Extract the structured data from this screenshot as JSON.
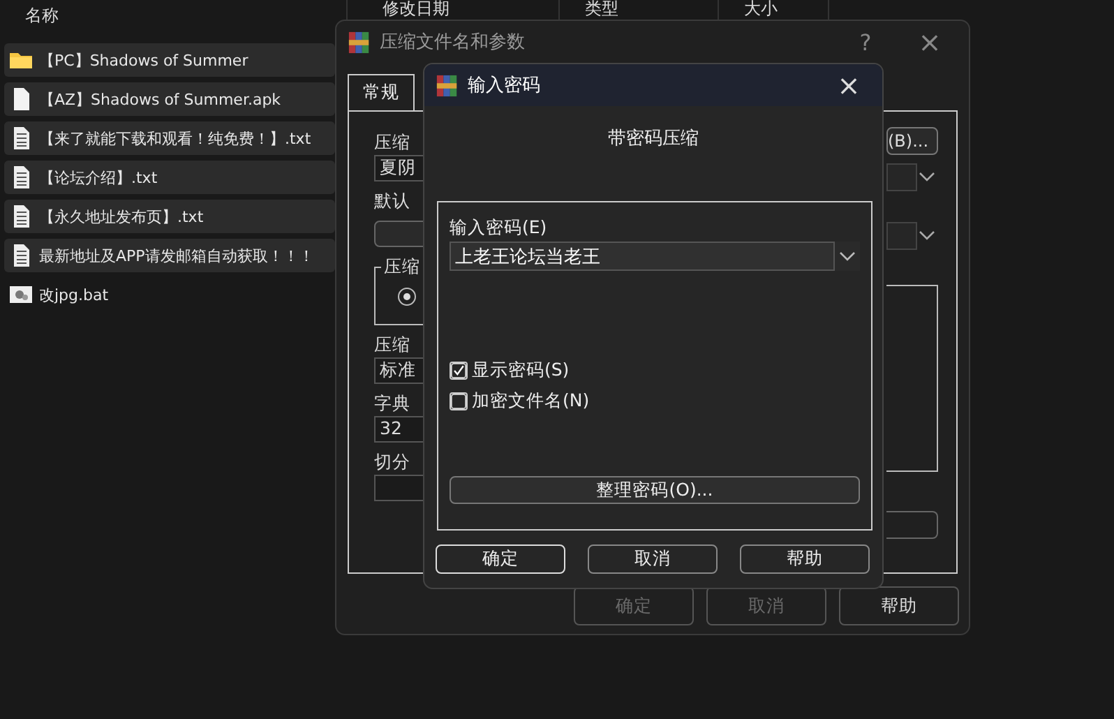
{
  "explorer": {
    "columns": [
      "名称",
      "修改日期",
      "类型",
      "大小"
    ],
    "files": [
      {
        "name": "【PC】Shadows of Summer",
        "kind": "folder",
        "selected": true
      },
      {
        "name": "【AZ】Shadows of Summer.apk",
        "kind": "file",
        "selected": true
      },
      {
        "name": "【来了就能下载和观看！纯免费！】.txt",
        "kind": "text",
        "selected": true
      },
      {
        "name": "【论坛介绍】.txt",
        "kind": "text",
        "selected": true
      },
      {
        "name": "【永久地址发布页】.txt",
        "kind": "text",
        "selected": true
      },
      {
        "name": "最新地址及APP请发邮箱自动获取！！！",
        "kind": "text",
        "selected": true
      },
      {
        "name": "改jpg.bat",
        "kind": "script",
        "selected": false
      }
    ]
  },
  "archive_dialog": {
    "title": "压缩文件名和参数",
    "help": "?",
    "close": "×",
    "tabs": [
      {
        "label": "常规",
        "selected": true
      }
    ],
    "left_items": [
      {
        "kind": "label",
        "text": "压缩"
      },
      {
        "kind": "field",
        "text": "夏阴"
      },
      {
        "kind": "label",
        "text": "默认"
      },
      {
        "kind": "button"
      },
      {
        "kind": "group",
        "text": "压缩",
        "selected": true
      },
      {
        "kind": "label",
        "text": "压缩"
      },
      {
        "kind": "field",
        "text": "标准"
      },
      {
        "kind": "label",
        "text": "字典"
      },
      {
        "kind": "field",
        "text": "32"
      },
      {
        "kind": "label",
        "text": "切分"
      },
      {
        "kind": "field"
      }
    ],
    "browse_button": "(B)...",
    "buttons": [
      {
        "label": "确定",
        "disabled": true
      },
      {
        "label": "取消",
        "disabled": true
      },
      {
        "label": "帮助",
        "disabled": false
      }
    ]
  },
  "password_dialog": {
    "title": "输入密码",
    "close": "×",
    "heading": "带密码压缩",
    "password_label": "输入密码(E)",
    "password_value": "上老王论坛当老王",
    "options": [
      {
        "label": "显示密码(S)",
        "checked": true
      },
      {
        "label": "加密文件名(N)",
        "checked": false
      }
    ],
    "organize_button": "整理密码(O)...",
    "buttons": [
      "确定",
      "取消",
      "帮助"
    ]
  }
}
